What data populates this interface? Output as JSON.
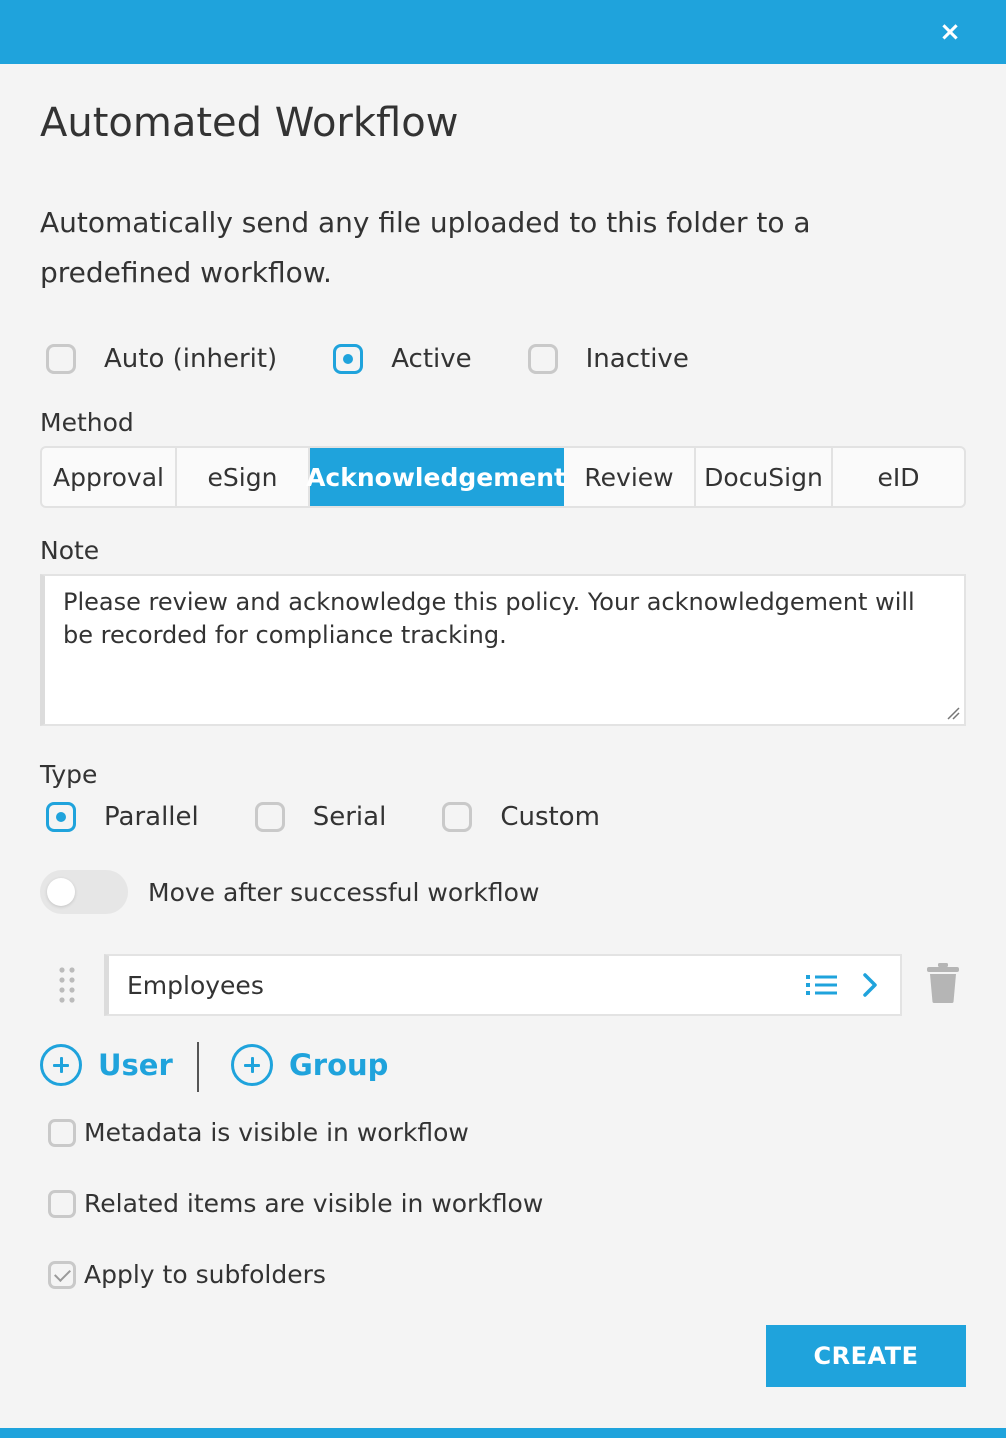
{
  "dialog": {
    "close_label": "×",
    "title": "Automated Workflow",
    "description": "Automatically send any file uploaded to this folder to a predefined workflow."
  },
  "status": {
    "options": [
      {
        "label": "Auto (inherit)",
        "selected": false
      },
      {
        "label": "Active",
        "selected": true
      },
      {
        "label": "Inactive",
        "selected": false
      }
    ]
  },
  "method": {
    "label": "Method",
    "tabs": [
      {
        "label": "Approval",
        "active": false
      },
      {
        "label": "eSign",
        "active": false
      },
      {
        "label": "Acknowledgement",
        "active": true
      },
      {
        "label": "Review",
        "active": false
      },
      {
        "label": "DocuSign",
        "active": false
      },
      {
        "label": "eID",
        "active": false
      }
    ]
  },
  "note": {
    "label": "Note",
    "value": "Please review and acknowledge this policy. Your acknowledgement will be recorded for compliance tracking."
  },
  "type": {
    "label": "Type",
    "options": [
      {
        "label": "Parallel",
        "selected": true
      },
      {
        "label": "Serial",
        "selected": false
      },
      {
        "label": "Custom",
        "selected": false
      }
    ]
  },
  "move_toggle": {
    "label": "Move after successful workflow",
    "on": false
  },
  "recipients": [
    {
      "name": "Employees",
      "icons": [
        "list-icon",
        "chevron-right-icon"
      ]
    }
  ],
  "add_buttons": {
    "user": "User",
    "group": "Group"
  },
  "checkboxes": [
    {
      "label": "Metadata is visible in workflow",
      "checked": false
    },
    {
      "label": "Related items are visible in workflow",
      "checked": false
    },
    {
      "label": "Apply to subfolders",
      "checked": true
    }
  ],
  "actions": {
    "create": "CREATE"
  },
  "colors": {
    "accent": "#1fa3dc",
    "background": "#f4f4f4"
  }
}
